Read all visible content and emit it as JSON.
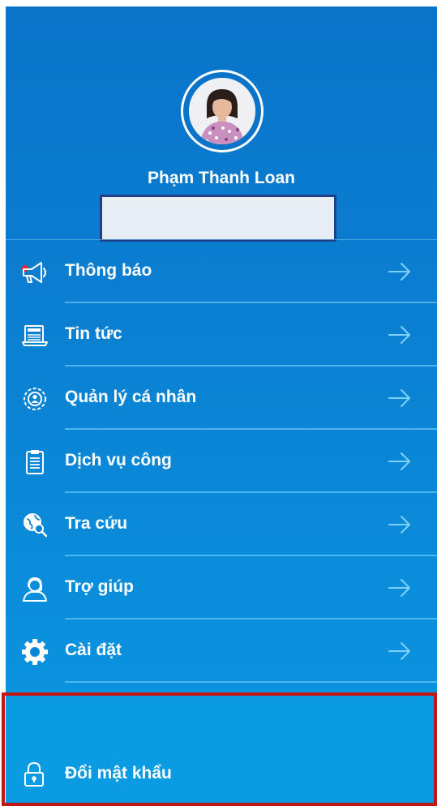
{
  "profile": {
    "name": "Phạm Thanh Loan"
  },
  "menu": {
    "items": [
      {
        "label": "Thông báo",
        "icon": "megaphone-icon"
      },
      {
        "label": "Tin tức",
        "icon": "newspaper-icon"
      },
      {
        "label": "Quản lý cá nhân",
        "icon": "personal-settings-icon"
      },
      {
        "label": "Dịch vụ công",
        "icon": "clipboard-icon"
      },
      {
        "label": "Tra cứu",
        "icon": "globe-search-icon"
      },
      {
        "label": "Trợ giúp",
        "icon": "support-agent-icon"
      },
      {
        "label": "Cài đặt",
        "icon": "gear-icon"
      }
    ]
  },
  "bottom": {
    "change_password_label": "Đổi mật khẩu",
    "icon": "lock-icon"
  },
  "colors": {
    "background_top": "#0a74c9",
    "background_bottom": "#0a9ae3",
    "highlight_frame": "#c01818",
    "notification_dot": "#e8262a"
  }
}
